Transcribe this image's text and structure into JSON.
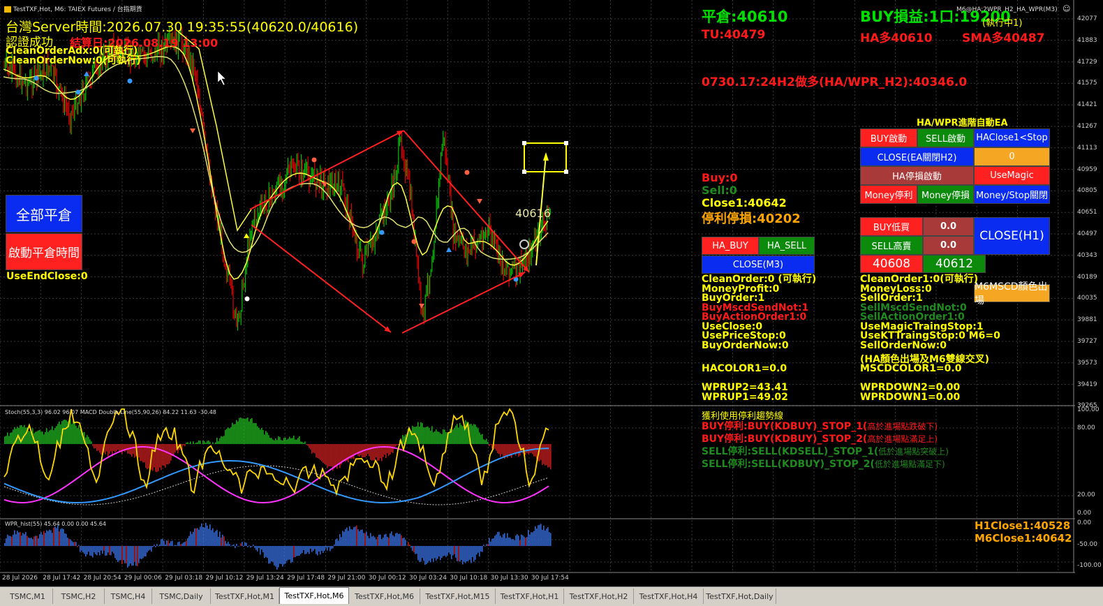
{
  "window": {
    "title": "TestTXF,Hot, M6:  TAIEX Futures / 台指期貨"
  },
  "header": {
    "server_time": "台灣Server時間:2026.07.30 19:35:55(40620.0/40616)",
    "auth": "認證成功",
    "settle": "結算日:2026.08.19 13:00",
    "clean_adx": "CleanOrderAdx:0(可執行)",
    "clean_now": "CleanOrderNow:0(可執行)"
  },
  "left_buttons": {
    "close_all": "全部平倉",
    "close_time": "啟動平倉時間",
    "use_end_close": "UseEndClose:0"
  },
  "chart": {
    "current_price_label": "40616",
    "price_axis": [
      "42077",
      "41883",
      "41729",
      "41575",
      "41421",
      "41267",
      "41113",
      "40959",
      "40805",
      "40651",
      "40497",
      "40343",
      "40189",
      "40035",
      "39881",
      "39727",
      "39573",
      "39419",
      "39265"
    ],
    "stoch_axis": [
      "100.00",
      "80.00",
      "20.00",
      "0.00"
    ],
    "wpr_axis": [
      "0.00",
      "-50.00",
      "-100.00"
    ],
    "time_axis": [
      "28 Jul 2026",
      "28 Jul 17:42",
      "28 Jul 20:54",
      "29 Jul 00:06",
      "29 Jul 03:18",
      "29 Jul 10:12",
      "29 Jul 13:24",
      "29 Jul 17:48",
      "29 Jul 21:00",
      "30 Jul 00:12",
      "30 Jul 03:24",
      "30 Jul 10:18",
      "30 Jul 13:30",
      "30 Jul 17:54"
    ],
    "stoch_label": "Stoch(55,3,3) 96.02 96.07 MACD Double Line(55,90,26) 84.22 11.63 -30.48",
    "wpr_label": "WPR_hist(55) 45.64 0.00 0.00 45.64",
    "ea_tag": "M6@HA:2WPR_H2_HA_WPR(M3)"
  },
  "right_panel": {
    "pingcang": "平倉:40610",
    "buy_pnl": "BUY損益:1口:19200",
    "exec_status": "(執行中1)",
    "tu": "TU:40479",
    "ha_long": "HA多40610",
    "sma_long": "SMA多40487",
    "signal": "0730.17:24H2做多(HA/WPR_H2):40346.0",
    "ea_title": "HA/WPR進階自動EA",
    "buy_cnt": "Buy:0",
    "sell_cnt": "Sell:0",
    "close1": "Close1:40642",
    "stop_profit": "停利停損:40202"
  },
  "ea_buttons": {
    "buy_start": "BUY啟動",
    "sell_start": "SELL啟動",
    "ha_close_stop": "HAClose1<Stop",
    "close_ea": "CLOSE(EA關閉H2)",
    "close_ea_val": "0",
    "ha_stoploss": "HA停損啟動",
    "use_magic": "UseMagic",
    "money_profit": "Money停利",
    "money_stop": "Money停損",
    "money_stop_close": "Money/Stop關閉",
    "ha_buy": "HA_BUY",
    "ha_sell": "HA_SELL",
    "close_m3": "CLOSE(M3)",
    "buy_low": "BUY低買",
    "buy_low_val": "0.0",
    "sell_high": "SELL高賣",
    "sell_high_val": "0.0",
    "close_h1": "CLOSE(H1)",
    "price_a": "40608",
    "price_b": "40612",
    "m6mscd": "M6MSCD顏色出場"
  },
  "status_left": [
    {
      "text": "CleanOrder:0 (可執行)",
      "color": "#ffff00"
    },
    {
      "text": "MoneyProfit:0",
      "color": "#ffff00"
    },
    {
      "text": "BuyOrder:1",
      "color": "#ffff00"
    },
    {
      "text": "BuyMscdSendNot:1",
      "color": "#ff1a1a"
    },
    {
      "text": "BuyActionOrder1:0",
      "color": "#ff1a1a"
    },
    {
      "text": "UseClose:0",
      "color": "#ffff00"
    },
    {
      "text": "UsePriceStop:0",
      "color": "#ffff00"
    },
    {
      "text": "BuyOrderNow:0",
      "color": "#ffff00"
    }
  ],
  "status_right": [
    {
      "text": "CleanOrder1:0(可執行)",
      "color": "#ffff00"
    },
    {
      "text": "MoneyLoss:0",
      "color": "#ffff00"
    },
    {
      "text": "SellOrder:1",
      "color": "#ffff00"
    },
    {
      "text": "SellMscdSendNot:0",
      "color": "#1f8a1f"
    },
    {
      "text": "SellActionOrder1:0",
      "color": "#1f8a1f"
    },
    {
      "text": "UseMagicTraingStop:1",
      "color": "#ffff00"
    },
    {
      "text": "UseKTTraingStop:0  M6=0",
      "color": "#ffff00"
    },
    {
      "text": "SellOrderNow:0",
      "color": "#ffff00"
    }
  ],
  "indicators": {
    "ha_color_note": "(HA顏色出場及M6雙線交叉)",
    "hacolor": "HACOLOR1=0.0",
    "mscdcolor": "MSCDCOLOR1=0.0",
    "wprup2": "WPRUP2=43.41",
    "wprup1": "WPRUP1=49.02",
    "wprdown2": "WPRDOWN2=0.00",
    "wprdown1": "WPRDOWN1=0.00"
  },
  "trend_notes": {
    "title": "獲利使用停利趨勢線",
    "lines": [
      {
        "main": "BUY停利:BUY(KDBUY)_STOP_1(",
        "sub": "高於進場點跌破下)",
        "color": "#ff1a1a"
      },
      {
        "main": "BUY停利:BUY(KDBUY)_STOP_2(",
        "sub": "高於進場點滿足上)",
        "color": "#ff1a1a"
      },
      {
        "main": "SELL停利:SELL(KDSELL)_STOP_1(",
        "sub": "低於進場點突破上)",
        "color": "#1f8a1f"
      },
      {
        "main": "SELL停利:SELL(KDBUY)_STOP_2(",
        "sub": "低於進場點滿足下)",
        "color": "#1f8a1f"
      }
    ]
  },
  "close_values": {
    "h1": "H1Close1:40528",
    "m6": "M6Close1:40642"
  },
  "tabs": [
    {
      "label": "TSMC,M1",
      "active": false
    },
    {
      "label": "TSMC,H2",
      "active": false
    },
    {
      "label": "TSMC,H4",
      "active": false
    },
    {
      "label": "TSMC,Daily",
      "active": false
    },
    {
      "label": "TestTXF,Hot,M1",
      "active": false
    },
    {
      "label": "TestTXF,Hot,M6",
      "active": true
    },
    {
      "label": "TestTXF,Hot,M6",
      "active": false
    },
    {
      "label": "TestTXF,Hot,M15",
      "active": false
    },
    {
      "label": "TestTXF,Hot,H1",
      "active": false
    },
    {
      "label": "TestTXF,Hot,H2",
      "active": false
    },
    {
      "label": "TestTXF,Hot,H4",
      "active": false
    },
    {
      "label": "TestTXF,Hot,Daily",
      "active": false
    }
  ],
  "colors": {
    "bg": "#000000",
    "grid": "#3a3a3a",
    "bull": "#00c000",
    "bear": "#e00000",
    "ma": "#ffff40",
    "trend": "#ff2020",
    "macd_main": "#3399ff",
    "macd_sig": "#ff33ff",
    "stoch": "#ffd700",
    "wpr": "#3366cc"
  }
}
